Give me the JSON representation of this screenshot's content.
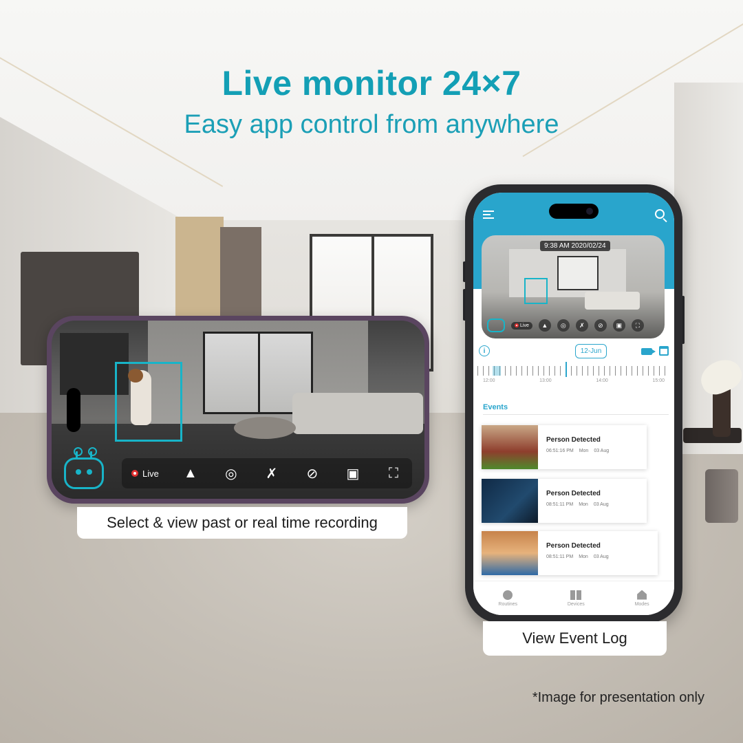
{
  "headline": "Live monitor 24×7",
  "subline": "Easy app control from anywhere",
  "landscape_phone": {
    "live_label": "Live",
    "controls": [
      {
        "name": "alarm-icon",
        "glyph": "▲"
      },
      {
        "name": "record-icon",
        "glyph": "◎"
      },
      {
        "name": "mic-off-icon",
        "glyph": "✗"
      },
      {
        "name": "speaker-mute-icon",
        "glyph": "⊘"
      },
      {
        "name": "snapshot-icon",
        "glyph": "▣"
      },
      {
        "name": "fullscreen-icon",
        "glyph": "⛶"
      }
    ],
    "caption": "Select & view past or real time recording"
  },
  "portrait_phone": {
    "timestamp": "9:38 AM 2020/02/24",
    "live_label": "Live",
    "date_selector": "12-Jun",
    "timeline_labels": [
      "12:00",
      "13:00",
      "14:00",
      "15:00"
    ],
    "events_title": "Events",
    "events": [
      {
        "title": "Person Detected",
        "time": "06:51:16 PM",
        "day": "Mon",
        "date": "03 Aug"
      },
      {
        "title": "Person Detected",
        "time": "08:51:11 PM",
        "day": "Mon",
        "date": "03 Aug"
      },
      {
        "title": "Person Detected",
        "time": "08:51:11 PM",
        "day": "Mon",
        "date": "03 Aug"
      }
    ],
    "nav": [
      {
        "label": "Routines",
        "icon": "clock-icon"
      },
      {
        "label": "Devices",
        "icon": "grid-icon"
      },
      {
        "label": "Modes",
        "icon": "home-icon"
      }
    ],
    "caption": "View Event Log"
  },
  "disclaimer": "*Image for presentation only",
  "colors": {
    "accent": "#139fb5",
    "app_header": "#29a5cc",
    "record_red": "#e03030"
  }
}
